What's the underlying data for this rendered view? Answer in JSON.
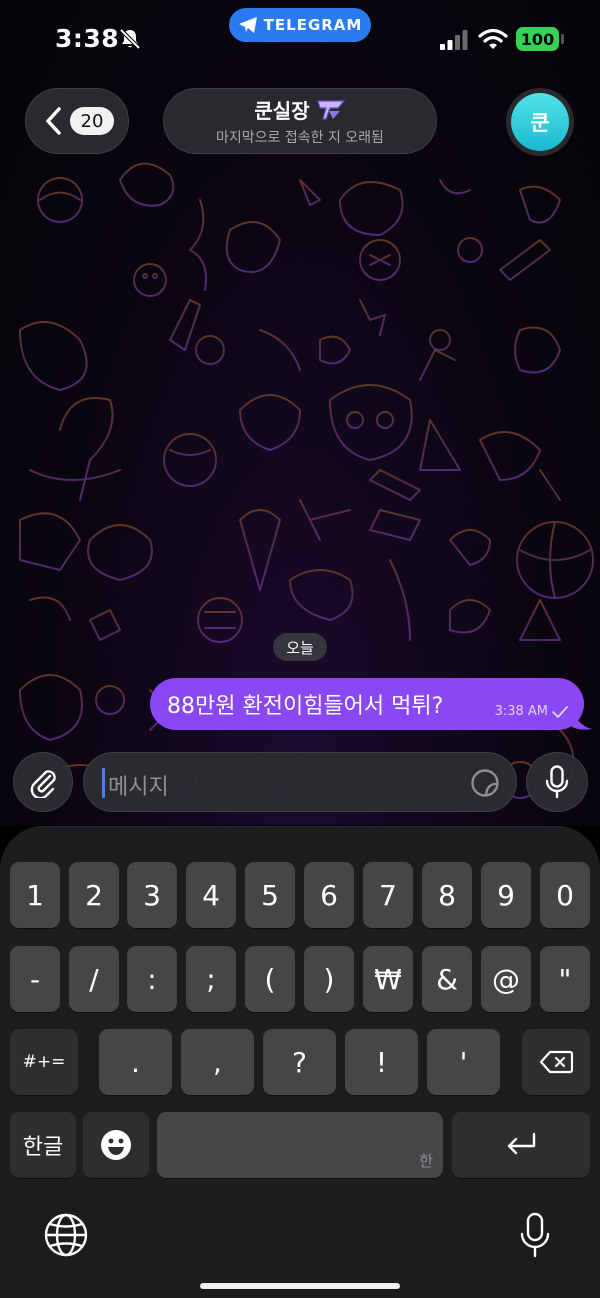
{
  "status_bar": {
    "time": "3:38",
    "app_pill": "TELEGRAM",
    "battery": "100"
  },
  "header": {
    "back_count": "20",
    "chat_name": "쿤실장",
    "chat_status": "마지막으로 접속한 지 오래됨",
    "avatar_letter": "쿤"
  },
  "messages": {
    "date_label": "오늘",
    "items": [
      {
        "text": "88만원 환전이힘들어서 먹튀?",
        "time": "3:38 AM",
        "outgoing": true
      }
    ]
  },
  "composer": {
    "placeholder": "메시지"
  },
  "keyboard": {
    "row1": [
      "1",
      "2",
      "3",
      "4",
      "5",
      "6",
      "7",
      "8",
      "9",
      "0"
    ],
    "row2": [
      "-",
      "/",
      ":",
      ";",
      "(",
      ")",
      "₩",
      "&",
      "@",
      "\""
    ],
    "row3_left": "#+=",
    "row3_punct": [
      ".",
      ",",
      "?",
      "!",
      "'"
    ],
    "lang_key": "한글",
    "space_hint": "한"
  },
  "colors": {
    "bubble": "#8a47f4",
    "accent_blue": "#2a7bf2",
    "avatar": "#2ccfe0",
    "battery": "#33d35a"
  }
}
